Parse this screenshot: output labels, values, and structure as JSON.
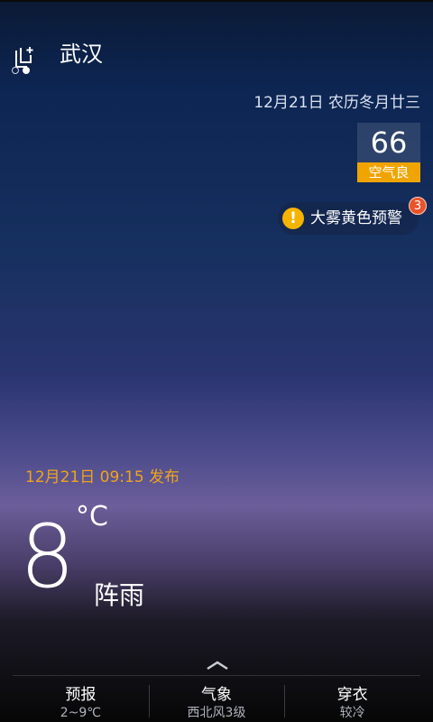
{
  "header": {
    "city": "武汉",
    "city_switch_icon": "add-city-icon"
  },
  "date_line": "12月21日 农历冬月廿三",
  "aqi": {
    "value": "66",
    "label": "空气良",
    "label_color": "#f0a400"
  },
  "alert": {
    "text": "大雾黄色预警",
    "badge": "3",
    "icon": "warning-icon"
  },
  "published": "12月21日 09:15 发布",
  "current": {
    "temp": "8",
    "unit": "°C",
    "condition": "阵雨"
  },
  "bottom_tabs": [
    {
      "title": "预报",
      "sub": "2~9℃"
    },
    {
      "title": "气象",
      "sub": "西北风3级"
    },
    {
      "title": "穿衣",
      "sub": "较冷"
    }
  ],
  "page_dots": {
    "count": 2,
    "active_index": 1
  }
}
